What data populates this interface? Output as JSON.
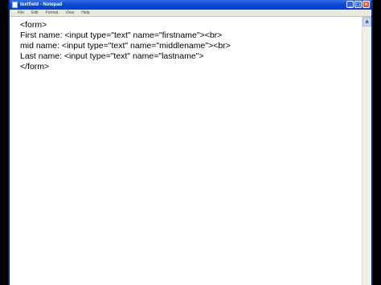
{
  "window": {
    "title": "textfield - Notepad"
  },
  "title_buttons": {
    "minimize": "_",
    "maximize": "□",
    "close": "×"
  },
  "menu": {
    "items": [
      "File",
      "Edit",
      "Format",
      "View",
      "Help"
    ]
  },
  "editor": {
    "lines": [
      "<form>",
      "First name: <input type=\"text\" name=\"firstname\"><br>",
      "mid name: <input type=\"text\" name=\"middlename\"><br>",
      "Last name: <input type=\"text\" name=\"lastname\">",
      "</form>"
    ]
  },
  "scrollbar": {
    "up_arrow": "▲"
  }
}
